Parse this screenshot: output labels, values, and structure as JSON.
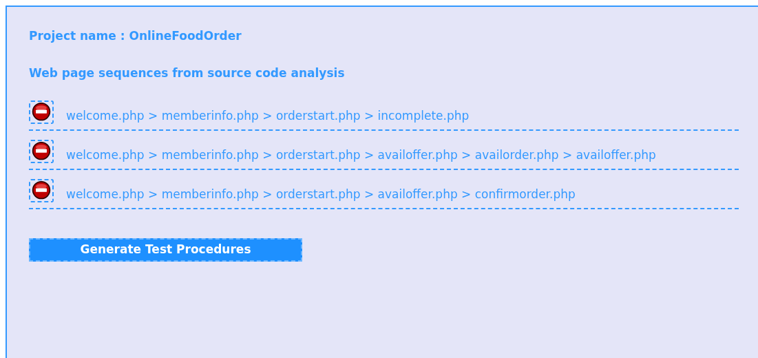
{
  "project_label": "Project name : OnlineFoodOrder",
  "heading": "Web page sequences from source code analysis",
  "sequences": [
    {
      "path": "welcome.php > memberinfo.php > orderstart.php > incomplete.php"
    },
    {
      "path": "welcome.php > memberinfo.php > orderstart.php > availoffer.php > availorder.php > availoffer.php"
    },
    {
      "path": "welcome.php > memberinfo.php > orderstart.php > availoffer.php > confirmorder.php"
    }
  ],
  "button": "Generate Test Procedures"
}
